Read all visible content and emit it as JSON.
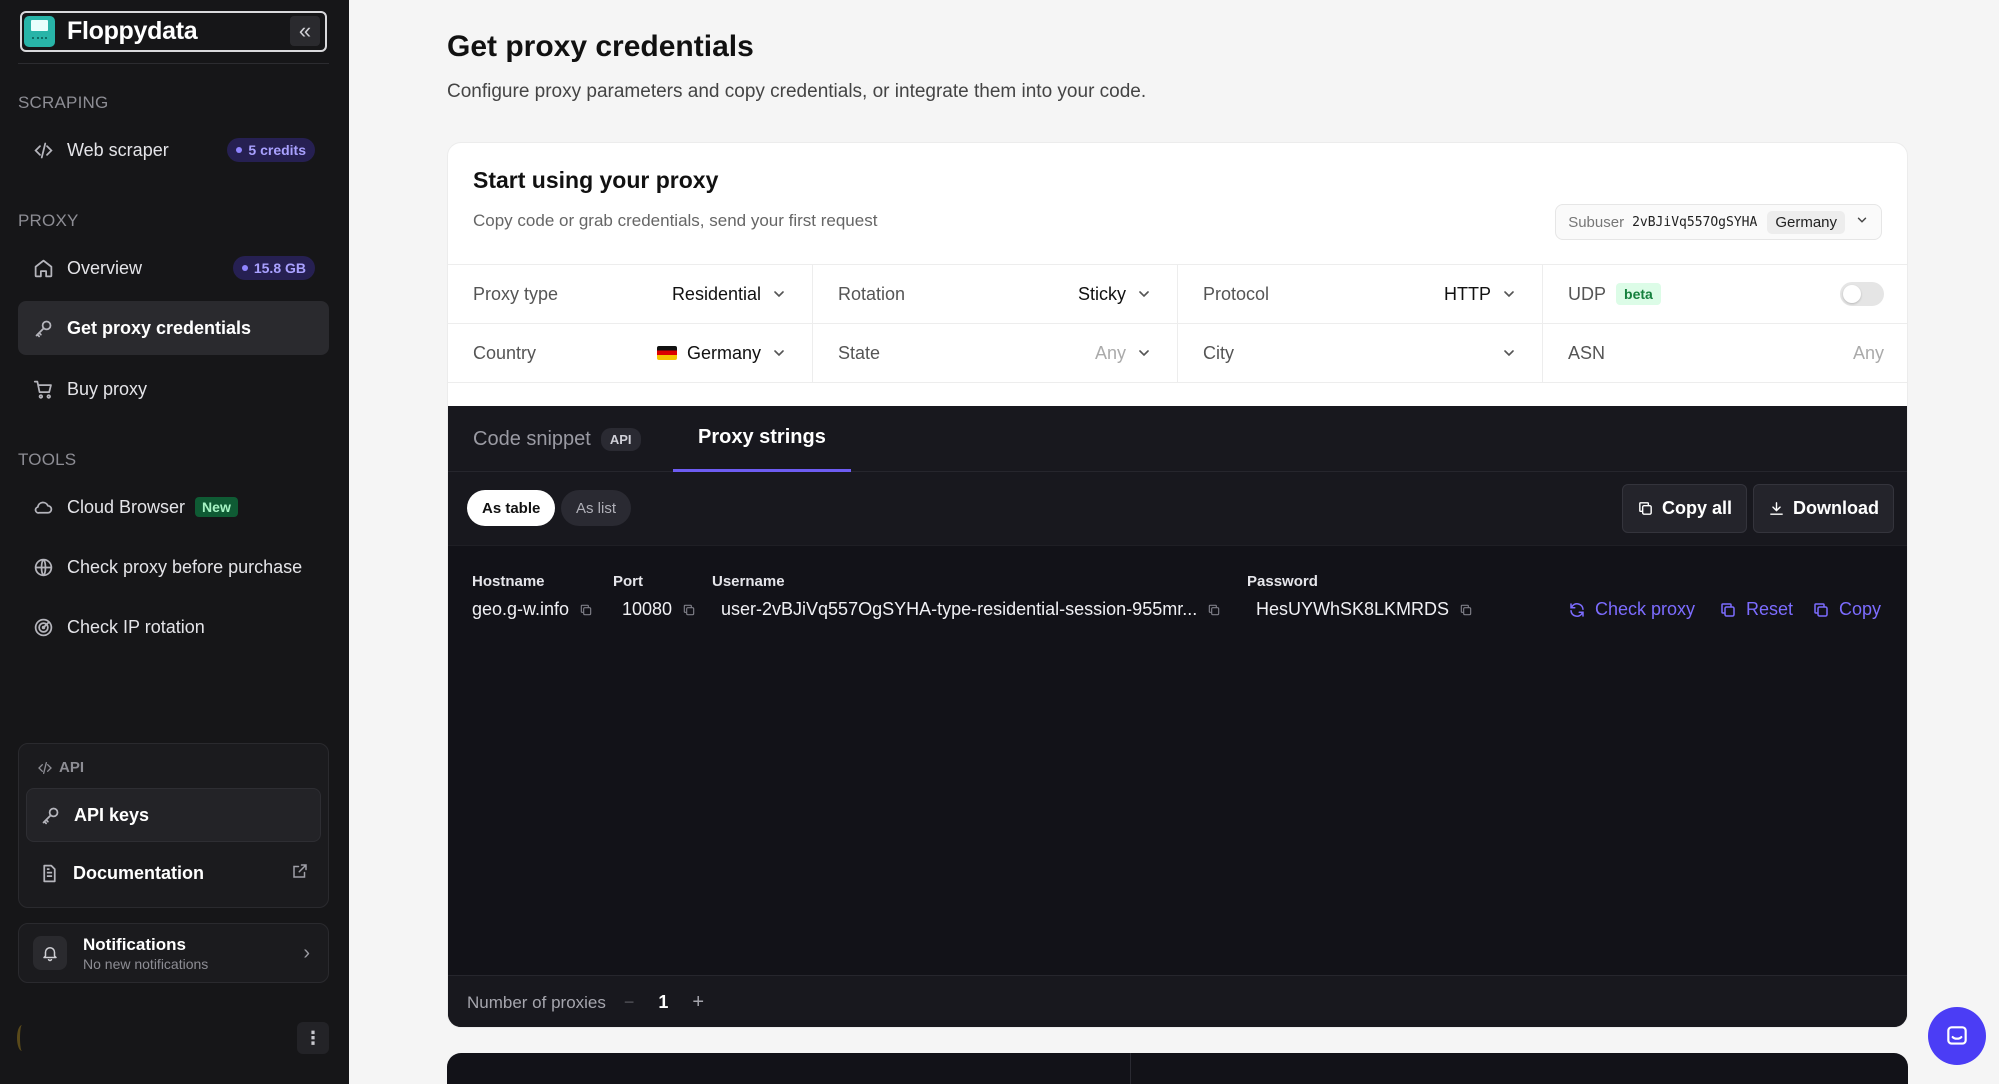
{
  "brand": {
    "name": "Floppydata"
  },
  "sidebar": {
    "sections": {
      "scraping": "SCRAPING",
      "proxy": "PROXY",
      "tools": "TOOLS"
    },
    "items": [
      {
        "label": "Web scraper",
        "badge": "5 credits",
        "icon": "code-icon"
      },
      {
        "label": "Overview",
        "badge": "15.8 GB",
        "icon": "home-icon"
      },
      {
        "label": "Get proxy credentials",
        "icon": "key-icon",
        "active": true
      },
      {
        "label": "Buy proxy",
        "icon": "cart-icon"
      },
      {
        "label": "Cloud Browser",
        "badge": "New",
        "icon": "cloud-icon"
      },
      {
        "label": "Check proxy before purchase",
        "icon": "globe-icon"
      },
      {
        "label": "Check IP rotation",
        "icon": "radar-icon"
      }
    ],
    "api": {
      "heading": "API",
      "keys_label": "API keys",
      "docs_label": "Documentation"
    },
    "notifications": {
      "title": "Notifications",
      "subtitle": "No new notifications"
    }
  },
  "header": {
    "title": "Get proxy credentials",
    "subtitle": "Configure proxy parameters and copy credentials, or integrate them into your code."
  },
  "card": {
    "title": "Start using your proxy",
    "subtitle": "Copy code or grab credentials, send your first request",
    "subuser": {
      "label": "Subuser",
      "id": "2vBJiVq557OgSYHA",
      "country": "Germany"
    }
  },
  "params": {
    "proxy_type": {
      "label": "Proxy type",
      "value": "Residential"
    },
    "rotation": {
      "label": "Rotation",
      "value": "Sticky"
    },
    "protocol": {
      "label": "Protocol",
      "value": "HTTP"
    },
    "udp": {
      "label": "UDP",
      "badge": "beta",
      "enabled": false
    },
    "country": {
      "label": "Country",
      "value": "Germany"
    },
    "state": {
      "label": "State",
      "value": "Any"
    },
    "city": {
      "label": "City",
      "value": ""
    },
    "asn": {
      "label": "ASN",
      "value": "Any"
    }
  },
  "tabs": {
    "code_snippet": "Code snippet",
    "api_tag": "API",
    "proxy_strings": "Proxy strings"
  },
  "view_toggle": {
    "as_table": "As table",
    "as_list": "As list",
    "selected": "As table"
  },
  "actions": {
    "copy_all": "Copy all",
    "download": "Download"
  },
  "table": {
    "headers": {
      "hostname": "Hostname",
      "port": "Port",
      "username": "Username",
      "password": "Password"
    },
    "row": {
      "hostname": "geo.g-w.info",
      "port": "10080",
      "username": "user-2vBJiVq557OgSYHA-type-residential-session-955mr...",
      "password": "HesUYWhSK8LKMRDS",
      "check_proxy": "Check proxy",
      "reset": "Reset",
      "copy": "Copy"
    }
  },
  "footer": {
    "label": "Number of proxies",
    "minus": "−",
    "count": "1",
    "plus": "+"
  },
  "colors": {
    "accent": "#6d5cf2",
    "sidebar_bg": "#161618",
    "panel_dark": "#121218",
    "link": "#7c6cff"
  }
}
